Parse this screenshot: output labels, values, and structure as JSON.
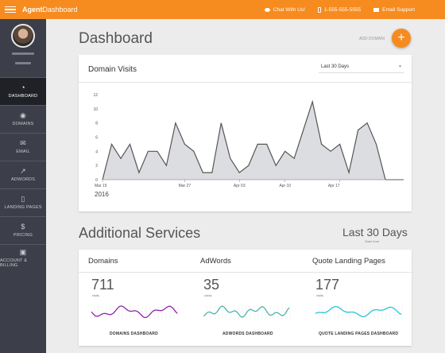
{
  "topbar": {
    "brand_bold": "Agent",
    "brand_light": "Dashboard",
    "links": [
      {
        "icon": "chat-icon",
        "label": "Chat With Us!"
      },
      {
        "icon": "phone-icon",
        "label": "1-555-555-5555"
      },
      {
        "icon": "mail-icon",
        "label": "Email Support"
      }
    ],
    "accent": "#f68b1f"
  },
  "sidebar": {
    "items": [
      {
        "key": "dashboard",
        "label": "DASHBOARD",
        "icon": "speedometer-icon",
        "glyph": "◔",
        "active": true
      },
      {
        "key": "domains",
        "label": "DOMAINS",
        "icon": "globe-icon",
        "glyph": "◉",
        "active": false
      },
      {
        "key": "email",
        "label": "EMAIL",
        "icon": "envelope-icon",
        "glyph": "✉",
        "active": false
      },
      {
        "key": "adwords",
        "label": "ADWORDS",
        "icon": "trend-chart-icon",
        "glyph": "↗",
        "active": false
      },
      {
        "key": "landing",
        "label": "LANDING PAGES",
        "icon": "document-icon",
        "glyph": "▯",
        "active": false
      },
      {
        "key": "pricing",
        "label": "PRICING",
        "icon": "dollar-icon",
        "glyph": "$",
        "active": false
      },
      {
        "key": "account",
        "label": "ACCOUNT & BILLING",
        "icon": "money-bill-icon",
        "glyph": "▣",
        "active": false
      }
    ]
  },
  "main": {
    "title": "Dashboard",
    "add_domain_label": "ADD DOMAIN",
    "fab_glyph": "+"
  },
  "visits_card": {
    "title": "Domain Visits",
    "range_value": "Last 30 Days",
    "year_label": "2016"
  },
  "chart_data": {
    "type": "area",
    "title": "Domain Visits",
    "xlabel": "",
    "ylabel": "",
    "ylim": [
      0,
      12
    ],
    "yticks": [
      0,
      2,
      4,
      6,
      8,
      10,
      12
    ],
    "x_tick_labels": [
      "Mar 15",
      "Mar 27",
      "Apr 03",
      "Apr 10",
      "Apr 17"
    ],
    "x_tick_index": [
      0,
      9,
      15,
      20,
      26
    ],
    "grid": false,
    "values": [
      0,
      5,
      3,
      5,
      1,
      4,
      4,
      2,
      8,
      5,
      4,
      1,
      1,
      8,
      3,
      1,
      2,
      5,
      5,
      2,
      4,
      3,
      7,
      11,
      5,
      4,
      5,
      1,
      7,
      8,
      5,
      0,
      0,
      0
    ],
    "fill_color": "#dcdde0",
    "line_color": "#555555"
  },
  "services": {
    "title": "Additional Services",
    "range_label": "Last 30 Days",
    "range_sub": "Stats from",
    "items": [
      {
        "key": "domains",
        "title": "Domains",
        "value": "711",
        "unit": "visits",
        "link": "DOMAINS DASHBOARD",
        "color": "#8e24aa"
      },
      {
        "key": "adwords",
        "title": "AdWords",
        "value": "35",
        "unit": "clicks",
        "link": "ADWORDS DASHBOARD",
        "color": "#4db6ac"
      },
      {
        "key": "landing",
        "title": "Quote Landing Pages",
        "value": "177",
        "unit": "visits",
        "link": "QUOTE LANDING PAGES DASHBOARD",
        "color": "#26c6da"
      }
    ]
  }
}
